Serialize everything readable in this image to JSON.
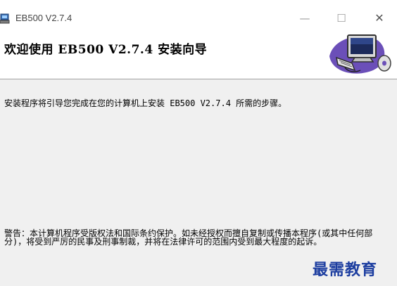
{
  "window": {
    "title": "EB500 V2.7.4",
    "icons": {
      "app": "installer-app-icon",
      "minimize": "minimize-icon",
      "maximize": "maximize-icon",
      "close": "close-icon"
    },
    "glyphs": {
      "minimize": "—",
      "maximize": "☐",
      "close": "✕"
    }
  },
  "header": {
    "title": "欢迎使用 EB500 V2.7.4 安装向导",
    "image": "computer-disk-icon"
  },
  "body": {
    "intro": "安装程序将引导您完成在您的计算机上安装 EB500 V2.7.4 所需的步骤。",
    "warning": "警告：本计算机程序受版权法和国际条约保护。如未经授权而擅自复制或传播本程序(或其中任何部分)，将受到严厉的民事及刑事制裁，并将在法律许可的范围内受到最大程度的起诉。"
  },
  "watermark": "最需教育",
  "colors": {
    "header_bg": "#ffffff",
    "body_bg": "#f0f0f0",
    "watermark": "#1d3ea0"
  }
}
